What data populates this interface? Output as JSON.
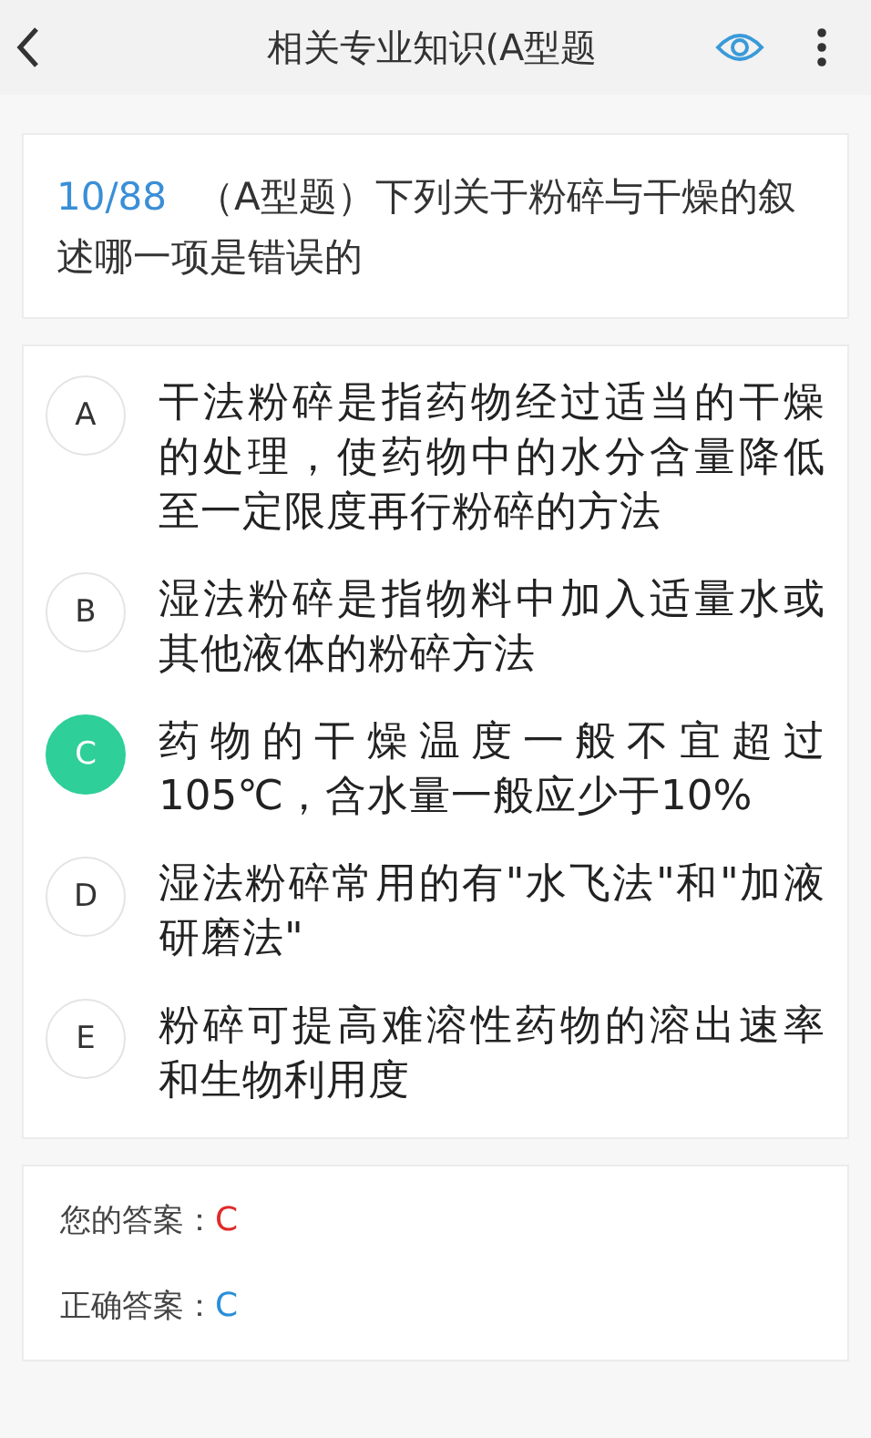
{
  "header": {
    "title": "相关专业知识(A型题"
  },
  "question": {
    "number": "10/88",
    "text": "（A型题）下列关于粉碎与干燥的叙述哪一项是错误的"
  },
  "options": [
    {
      "letter": "A",
      "text": "干法粉碎是指药物经过适当的干燥的处理，使药物中的水分含量降低至一定限度再行粉碎的方法",
      "selected": false
    },
    {
      "letter": "B",
      "text": "湿法粉碎是指物料中加入适量水或其他液体的粉碎方法",
      "selected": false
    },
    {
      "letter": "C",
      "text": "药物的干燥温度一般不宜超过105℃，含水量一般应少于10%",
      "selected": true
    },
    {
      "letter": "D",
      "text": "湿法粉碎常用的有\"水飞法\"和\"加液研磨法\"",
      "selected": false
    },
    {
      "letter": "E",
      "text": "粉碎可提高难溶性药物的溶出速率和生物利用度",
      "selected": false
    }
  ],
  "answers": [
    {
      "label": "您的答案：",
      "value": "C",
      "color": "#e02a2a"
    },
    {
      "label": "正确答案：",
      "value": "C",
      "color": "#2a8fd8"
    }
  ]
}
